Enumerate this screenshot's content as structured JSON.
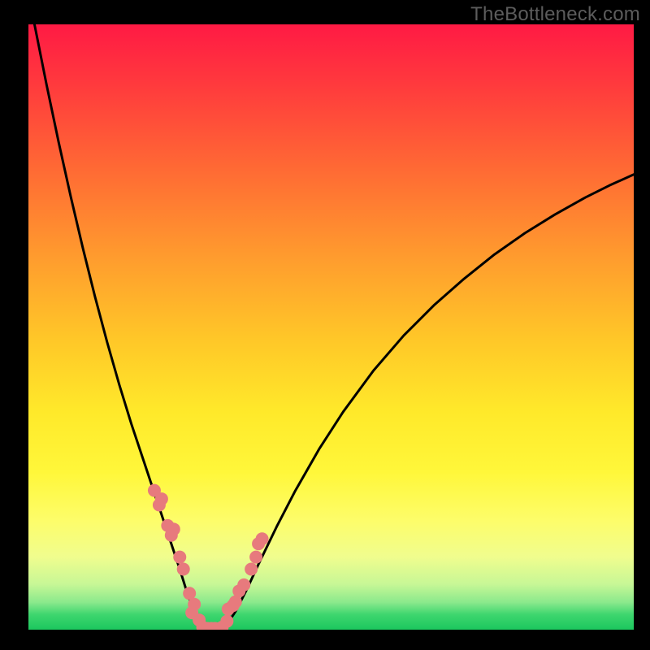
{
  "watermark": "TheBottleneck.com",
  "colors": {
    "marker": "#e77a7d",
    "curve": "#000000"
  },
  "chart_data": {
    "type": "line",
    "title": "",
    "xlabel": "",
    "ylabel": "",
    "xlim": [
      0,
      100
    ],
    "ylim": [
      0,
      100
    ],
    "grid": false,
    "series": [
      {
        "name": "left-curve",
        "x": [
          1,
          3,
          5,
          7,
          9,
          11,
          13,
          15,
          17,
          19,
          20.5,
          22,
          23.5,
          25,
          26,
          27,
          27.8,
          28.3,
          28.7
        ],
        "y": [
          100,
          90,
          80.5,
          71.5,
          63,
          55,
          47.5,
          40.5,
          34,
          28,
          23.5,
          19,
          14.5,
          10,
          6.8,
          4,
          2,
          0.8,
          0.2
        ]
      },
      {
        "name": "valley-floor",
        "x": [
          28.7,
          29.5,
          30.5,
          31.5,
          32.1
        ],
        "y": [
          0.2,
          0.0,
          0.0,
          0.0,
          0.2
        ]
      },
      {
        "name": "right-curve",
        "x": [
          32.1,
          33,
          34.2,
          36,
          38,
          41,
          44,
          48,
          52,
          57,
          62,
          67,
          72,
          77,
          82,
          87,
          92,
          96,
          100
        ],
        "y": [
          0.2,
          1.2,
          3,
          6.5,
          10.8,
          17,
          22.8,
          29.8,
          36,
          42.8,
          48.6,
          53.6,
          58,
          62,
          65.5,
          68.6,
          71.4,
          73.4,
          75.2
        ]
      }
    ],
    "markers": [
      {
        "name": "left-cluster",
        "x": [
          20.8,
          21.6,
          22.0,
          23.0,
          23.6,
          24.0,
          25.0,
          25.6,
          26.6,
          27.4,
          27.0,
          28.2
        ],
        "y": [
          23.0,
          20.6,
          21.6,
          17.2,
          15.6,
          16.6,
          12.0,
          10.0,
          6.0,
          4.2,
          2.8,
          1.6
        ]
      },
      {
        "name": "valley-cluster",
        "x": [
          28.8,
          29.6,
          30.2,
          30.8,
          31.6,
          32.0
        ],
        "y": [
          0.4,
          0.2,
          0.2,
          0.2,
          0.2,
          0.4
        ]
      },
      {
        "name": "right-cluster",
        "x": [
          32.8,
          33.0,
          33.8,
          34.2,
          34.8,
          35.6,
          36.8,
          37.6,
          38.0,
          38.6
        ],
        "y": [
          1.4,
          3.4,
          4.0,
          4.6,
          6.4,
          7.4,
          10.0,
          12.0,
          14.2,
          15.0
        ]
      }
    ]
  }
}
